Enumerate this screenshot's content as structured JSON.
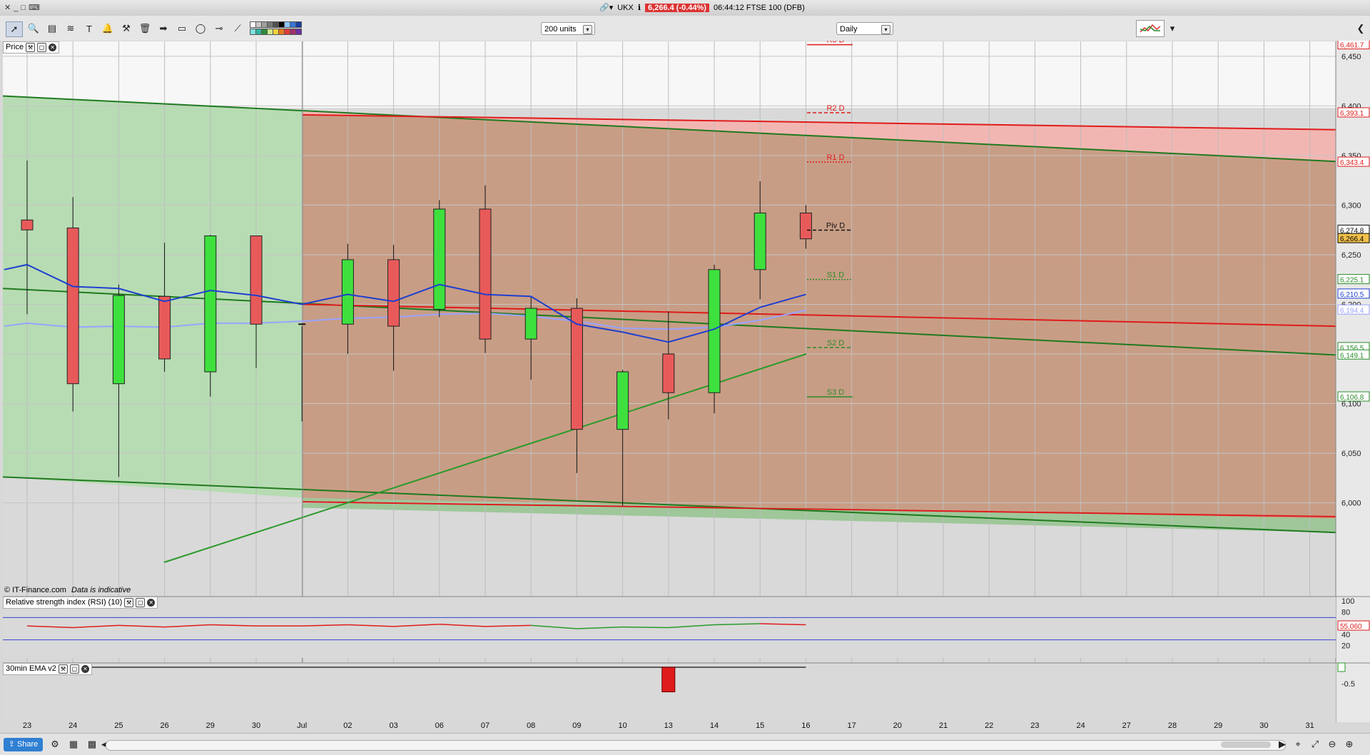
{
  "window": {
    "symbol": "UKX",
    "price_chip": "6,266.4 (-0.44%)",
    "clock_title": "06:44:12 FTSE 100 (DFB)"
  },
  "toolbar": {
    "units": "200 units",
    "interval": "Daily",
    "swatch_colors": [
      "#ffffff",
      "#c8c8c8",
      "#a0a0a0",
      "#787878",
      "#505050",
      "#000000",
      "#8ec5ff",
      "#3a76d8",
      "#1a3fa0",
      "#7fe0e0",
      "#31b0a0",
      "#2f8a3a",
      "#cfe88a",
      "#f2d23e",
      "#e87b1f",
      "#e33a3a",
      "#a1306c",
      "#6b2fa0"
    ]
  },
  "panels": {
    "price_label": "Price",
    "rsi_label": "Relative strength index (RSI) (10)",
    "ema_label": "30min EMA v2",
    "copyright": "© IT-Finance.com",
    "indicative": "Data is indicative"
  },
  "chart_data": {
    "type": "candlestick",
    "x_labels": [
      "23",
      "24",
      "25",
      "26",
      "29",
      "30",
      "Jul",
      "02",
      "03",
      "06",
      "07",
      "08",
      "09",
      "10",
      "13",
      "14",
      "15",
      "16",
      "17",
      "20",
      "21",
      "22",
      "23",
      "24",
      "27",
      "28",
      "29",
      "30",
      "31"
    ],
    "y_ticks": [
      "6,450",
      "6,400",
      "6,350",
      "6,300",
      "6,250",
      "6,200",
      "6,150",
      "6,100",
      "6,050",
      "6,000"
    ],
    "ylim": [
      5940,
      6465
    ],
    "candles": [
      {
        "x": 0,
        "o": 6285,
        "c": 6275,
        "h": 6345,
        "l": 6190
      },
      {
        "x": 1,
        "o": 6277,
        "c": 6120,
        "h": 6308,
        "l": 6092
      },
      {
        "x": 2,
        "o": 6120,
        "c": 6209,
        "h": 6220,
        "l": 6026
      },
      {
        "x": 3,
        "o": 6208,
        "c": 6145,
        "h": 6262,
        "l": 6132
      },
      {
        "x": 4,
        "o": 6132,
        "c": 6269,
        "h": 6270,
        "l": 6107
      },
      {
        "x": 5,
        "o": 6269,
        "c": 6180,
        "h": 6268,
        "l": 6136
      },
      {
        "x": 7,
        "o": 6180,
        "c": 6245,
        "h": 6261,
        "l": 6150
      },
      {
        "x": 8,
        "o": 6245,
        "c": 6178,
        "h": 6260,
        "l": 6133
      },
      {
        "x": 9,
        "o": 6195,
        "c": 6296,
        "h": 6305,
        "l": 6187
      },
      {
        "x": 10,
        "o": 6296,
        "c": 6165,
        "h": 6320,
        "l": 6151
      },
      {
        "x": 11,
        "o": 6165,
        "c": 6196,
        "h": 6208,
        "l": 6124
      },
      {
        "x": 12,
        "o": 6196,
        "c": 6074,
        "h": 6206,
        "l": 6030
      },
      {
        "x": 13,
        "o": 6074,
        "c": 6132,
        "h": 6134,
        "l": 5997
      },
      {
        "x": 14,
        "o": 6150,
        "c": 6111,
        "h": 6193,
        "l": 6084
      },
      {
        "x": 15,
        "o": 6111,
        "c": 6235,
        "h": 6240,
        "l": 6090
      },
      {
        "x": 16,
        "o": 6235,
        "c": 6292,
        "h": 6324,
        "l": 6205
      },
      {
        "x": 17,
        "o": 6292,
        "c": 6266,
        "h": 6300,
        "l": 6256
      }
    ],
    "ema_fast": [
      [
        -0.5,
        6235
      ],
      [
        0,
        6240
      ],
      [
        1,
        6218
      ],
      [
        2,
        6216
      ],
      [
        3,
        6203
      ],
      [
        4,
        6214
      ],
      [
        5,
        6209
      ],
      [
        6,
        6200
      ],
      [
        7,
        6210
      ],
      [
        8,
        6203
      ],
      [
        9,
        6220
      ],
      [
        10,
        6210
      ],
      [
        11,
        6208
      ],
      [
        12,
        6180
      ],
      [
        13,
        6172
      ],
      [
        14,
        6162
      ],
      [
        15,
        6175
      ],
      [
        16,
        6197
      ],
      [
        17,
        6210
      ]
    ],
    "ema_slow": [
      [
        -0.5,
        6178
      ],
      [
        0,
        6181
      ],
      [
        1,
        6177
      ],
      [
        2,
        6178
      ],
      [
        3,
        6177
      ],
      [
        4,
        6181
      ],
      [
        5,
        6181
      ],
      [
        6,
        6183
      ],
      [
        7,
        6186
      ],
      [
        8,
        6187
      ],
      [
        9,
        6190
      ],
      [
        10,
        6191
      ],
      [
        11,
        6188
      ],
      [
        12,
        6183
      ],
      [
        13,
        6176
      ],
      [
        14,
        6175
      ],
      [
        15,
        6177
      ],
      [
        16,
        6184
      ],
      [
        17,
        6194
      ]
    ],
    "pivots": [
      {
        "label": "R3 D",
        "value": 6461.7,
        "tag": "6,461.7",
        "color": "#e01b1b",
        "dash": "0"
      },
      {
        "label": "R2 D",
        "value": 6393.1,
        "tag": "6,393.1",
        "color": "#e01b1b",
        "dash": "5,3"
      },
      {
        "label": "R1 D",
        "value": 6343.4,
        "tag": "6,343.4",
        "color": "#e01b1b",
        "dash": "2,2"
      },
      {
        "label": "Piv D",
        "value": 6274.8,
        "tag": "6,274.8",
        "color": "#111111",
        "dash": "5,3"
      },
      {
        "label": "S1 D",
        "value": 6225.1,
        "tag": "6,225.1",
        "color": "#2a8c2a",
        "dash": "2,2"
      },
      {
        "label": "S2 D",
        "value": 6156.5,
        "tag": "6,156.5",
        "color": "#2a8c2a",
        "dash": "5,3"
      },
      {
        "label": "S3 D",
        "value": 6106.8,
        "tag": "6,106.8",
        "color": "#2a8c2a",
        "dash": "0"
      }
    ],
    "right_tags": [
      {
        "value": 6266.4,
        "text": "6,266.4",
        "bg": "#f2c04a",
        "fg": "#000000"
      },
      {
        "value": 6210.5,
        "text": "6,210.5",
        "bg": "#ffffff",
        "fg": "#1f3fd0"
      },
      {
        "value": 6194.4,
        "text": "6,194.4",
        "bg": "#ffffff",
        "fg": "#9aa3ff"
      },
      {
        "value": 6149.1,
        "text": "6,149.1",
        "bg": "#ffffff",
        "fg": "#2a8c2a"
      }
    ],
    "rsi": {
      "ticks": [
        "100",
        "80",
        "60",
        "40",
        "20"
      ],
      "values": [
        55,
        52,
        56,
        53,
        57,
        55,
        55,
        57,
        54,
        58,
        54,
        56,
        50,
        53,
        52,
        57,
        59,
        57
      ],
      "last_tag": "55.060"
    },
    "ema_osc": {
      "ticks": [
        "0",
        "-0.5"
      ],
      "bar_x": 14,
      "bar_value": -0.75
    }
  }
}
